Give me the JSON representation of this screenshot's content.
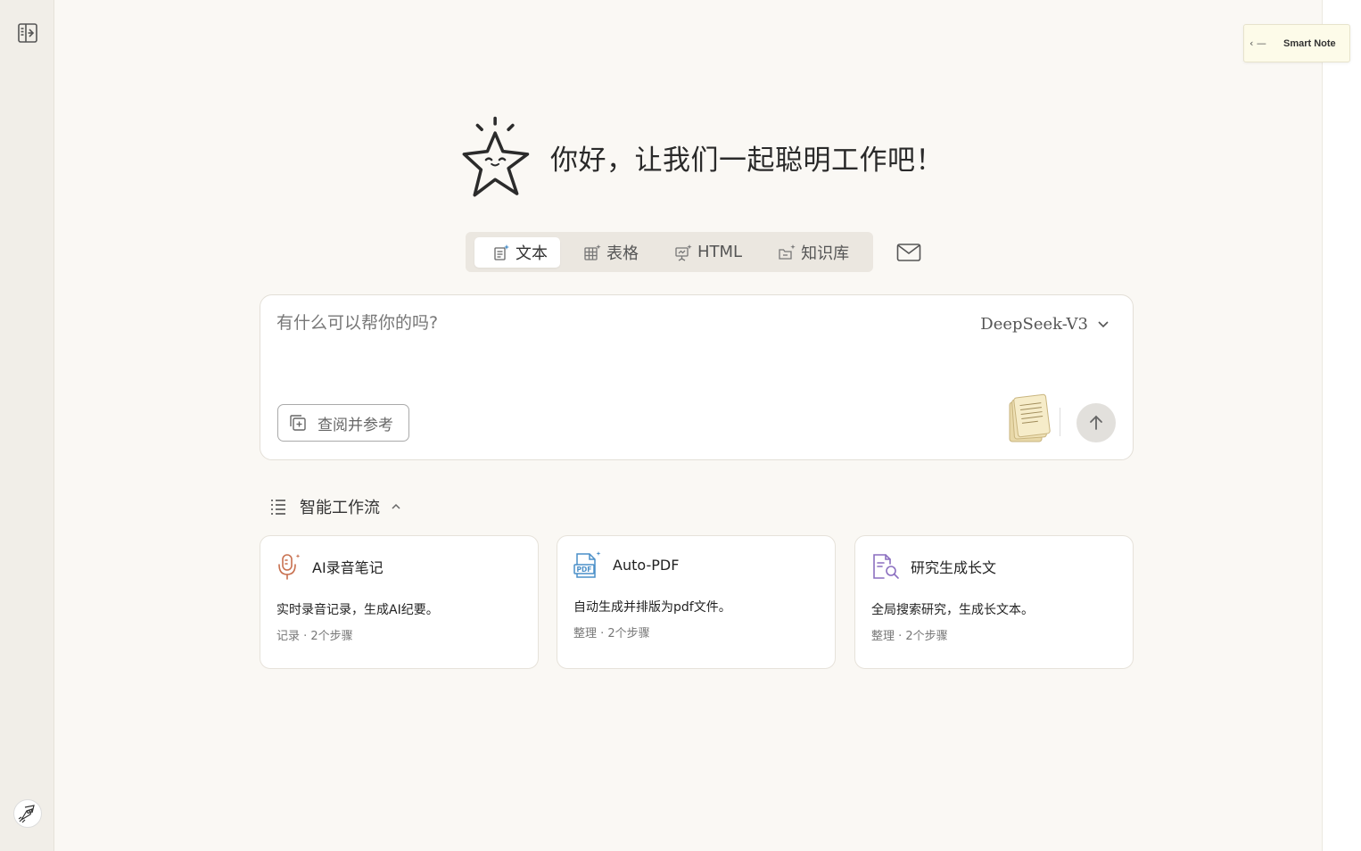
{
  "smart_note": {
    "arrow": "‹ —",
    "label": "Smart Note"
  },
  "hero": {
    "greeting": "你好，让我们一起聪明工作吧！"
  },
  "mode_tabs": [
    {
      "label": "文本",
      "icon": "doc-sparkle-icon",
      "active": true
    },
    {
      "label": "表格",
      "icon": "table-sparkle-icon",
      "active": false
    },
    {
      "label": "HTML",
      "icon": "presentation-sparkle-icon",
      "active": false
    },
    {
      "label": "知识库",
      "icon": "folder-sparkle-icon",
      "active": false
    }
  ],
  "composer": {
    "placeholder": "有什么可以帮你的吗?",
    "model": "DeepSeek-V3",
    "reference_button": "查阅并参考"
  },
  "workflows": {
    "title": "智能工作流",
    "items": [
      {
        "name": "AI录音笔记",
        "desc": "实时录音记录，生成AI纪要。",
        "meta": "记录 · 2个步骤",
        "icon": "microphone-sparkle-icon",
        "color": "#c8704f"
      },
      {
        "name": "Auto-PDF",
        "desc": "自动生成并排版为pdf文件。",
        "meta": "整理 · 2个步骤",
        "icon": "pdf-sparkle-icon",
        "color": "#4a8fc8"
      },
      {
        "name": "研究生成长文",
        "desc": "全局搜索研究，生成长文本。",
        "meta": "整理 · 2个步骤",
        "icon": "doc-search-icon",
        "color": "#8b6fc0"
      }
    ]
  },
  "colors": {
    "background": "#faf8f4",
    "sidebar": "#f1eee8",
    "tabs_bg": "#ebe7e0",
    "send_bg": "#e2e0dc"
  }
}
